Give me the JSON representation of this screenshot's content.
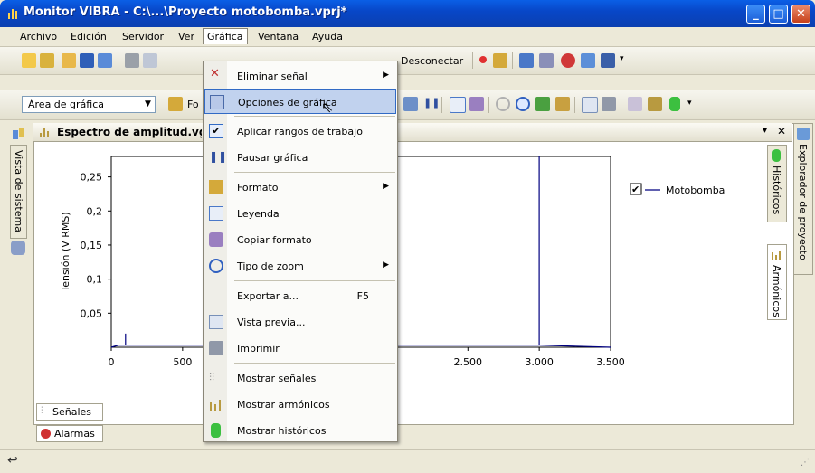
{
  "window": {
    "title": "Monitor VIBRA - C:\\...\\Proyecto motobomba.vprj*",
    "minimize_icon": "minimize-icon",
    "maximize_icon": "maximize-icon",
    "close_icon": "close-icon"
  },
  "menubar": {
    "items": [
      {
        "label": "Archivo"
      },
      {
        "label": "Edición"
      },
      {
        "label": "Servidor"
      },
      {
        "label": "Ver"
      },
      {
        "label": "Gráfica"
      },
      {
        "label": "Ventana"
      },
      {
        "label": "Ayuda"
      }
    ]
  },
  "toolbar1": {
    "disconnect_label": "Desconectar"
  },
  "toolbar2": {
    "area_combo_value": "Área de gráfica",
    "format_label": "Fo"
  },
  "left_panel": {
    "tab_label": "Vista de sistema"
  },
  "document": {
    "tab_title": "Espectro de amplitud.vg",
    "pin_icon": "pin-icon",
    "close_icon": "close-icon"
  },
  "right_panels": {
    "historicos_label": "Históricos",
    "armonicos_label": "Armónicos",
    "explorer_label": "Explorador de proyecto"
  },
  "bottom_tabs": {
    "senales_label": "Señales",
    "alarmas_label": "Alarmas"
  },
  "chart_data": {
    "type": "line",
    "ylabel": "Tensión (V RMS)",
    "xlabel": "",
    "yticks": [
      "0,25",
      "0,2",
      "0,15",
      "0,1",
      "0,05"
    ],
    "ytick_values": [
      0.25,
      0.2,
      0.15,
      0.1,
      0.05
    ],
    "xticks": [
      "0",
      "500",
      "0",
      "2.500",
      "3.000",
      "3.500"
    ],
    "xtick_values": [
      0,
      500,
      1000,
      2500,
      3000,
      3500
    ],
    "xlim": [
      0,
      3500
    ],
    "ylim": [
      0,
      0.28
    ],
    "series": [
      {
        "name": "Motobomba",
        "color": "#000080",
        "x": [
          0,
          50,
          100,
          100,
          100,
          150,
          2995,
          3000,
          3000,
          3000,
          3005,
          3500
        ],
        "y": [
          0,
          0.003,
          0.003,
          0.02,
          0.003,
          0.003,
          0.003,
          0.003,
          0.28,
          0.003,
          0.003,
          0
        ]
      }
    ],
    "legend": {
      "position": "top-right",
      "checked": true
    },
    "grid": false
  },
  "dropdown": {
    "items": [
      {
        "label": "Eliminar señal",
        "icon": "delete-signal-icon",
        "submenu": true
      },
      {
        "label": "Opciones de gráfica",
        "icon": "chart-options-icon",
        "hover": true
      },
      {
        "label": "Aplicar rangos de trabajo",
        "icon": "check-icon"
      },
      {
        "label": "Pausar gráfica",
        "icon": "pause-icon"
      },
      {
        "label": "Formato",
        "icon": "format-icon",
        "submenu": true
      },
      {
        "label": "Leyenda",
        "icon": "legend-icon"
      },
      {
        "label": "Copiar formato",
        "icon": "brush-icon"
      },
      {
        "label": "Tipo de zoom",
        "icon": "zoom-icon",
        "submenu": true
      },
      {
        "label": "Exportar a...",
        "icon": "",
        "shortcut": "F5"
      },
      {
        "label": "Vista previa...",
        "icon": "preview-icon"
      },
      {
        "label": "Imprimir",
        "icon": "print-icon"
      },
      {
        "label": "Mostrar señales",
        "icon": "signals-icon"
      },
      {
        "label": "Mostrar armónicos",
        "icon": "harmonics-icon"
      },
      {
        "label": "Mostrar históricos",
        "icon": "history-icon"
      }
    ]
  },
  "colors": {
    "titlebar": "#0847c8",
    "menu_hover": "#c1d2ee",
    "series_line": "#000080"
  }
}
